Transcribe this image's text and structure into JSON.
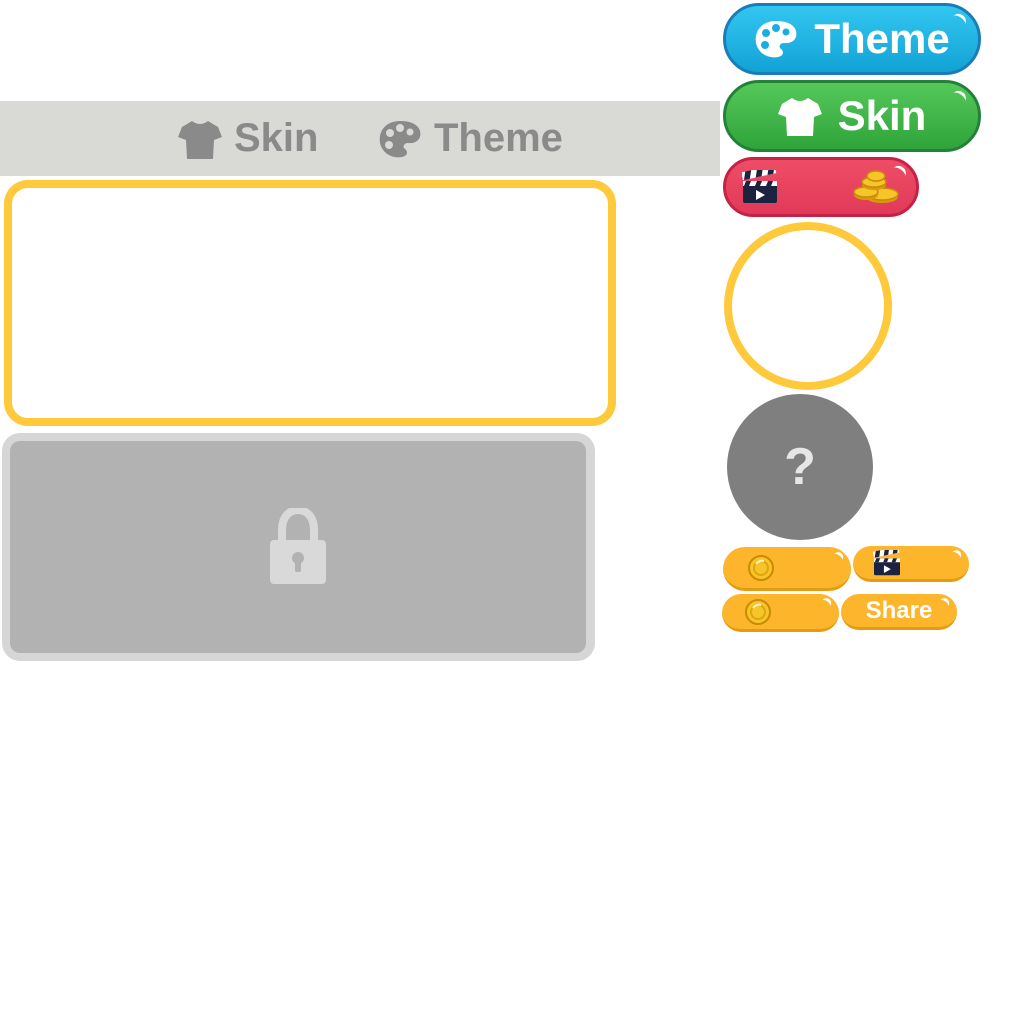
{
  "tabs": {
    "skin_label": "Skin",
    "theme_label": "Theme"
  },
  "buttons": {
    "theme_label": "Theme",
    "skin_label": "Skin",
    "share_label": "Share"
  },
  "mystery": {
    "symbol": "?"
  },
  "icons": {
    "tab_skin": "tshirt-icon",
    "tab_theme": "palette-icon",
    "btn_theme": "palette-icon",
    "btn_skin": "tshirt-icon",
    "ad": "clapperboard-icon",
    "coins": "coin-stack-icon",
    "coin": "coin-icon",
    "lock": "lock-icon"
  },
  "colors": {
    "accent_yellow": "#fec93a",
    "theme_blue": "#1fb2e3",
    "skin_green": "#3db54a",
    "ad_red": "#e8435f",
    "small_button_yellow": "#fdb52b",
    "tabbar_gray": "#d9d9d5",
    "locked_gray": "#b2b2b2"
  }
}
